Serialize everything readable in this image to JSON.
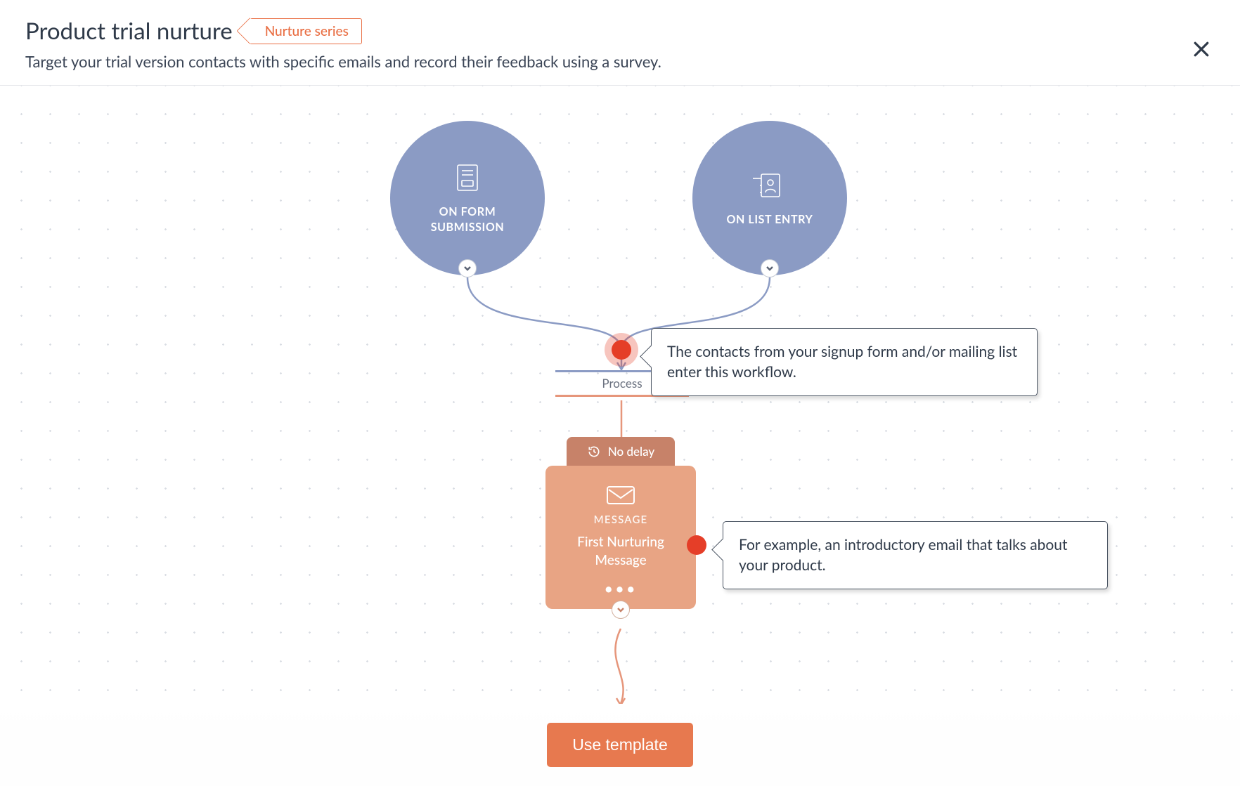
{
  "header": {
    "title": "Product trial nurture",
    "tag": "Nurture series",
    "description": "Target your trial version contacts with specific emails and record their feedback using a survey."
  },
  "triggers": {
    "form": {
      "label_line1": "ON FORM",
      "label_line2": "SUBMISSION"
    },
    "list": {
      "label": "ON LIST ENTRY"
    }
  },
  "process": {
    "label": "Process"
  },
  "message_node": {
    "delay_label": "No delay",
    "type_label": "MESSAGE",
    "title": "First Nurturing Message"
  },
  "tooltips": {
    "entry": "The contacts from your signup form and/or mailing list enter this workflow.",
    "message": "For example, an introductory email that talks about your product."
  },
  "footer": {
    "cta": "Use template"
  }
}
